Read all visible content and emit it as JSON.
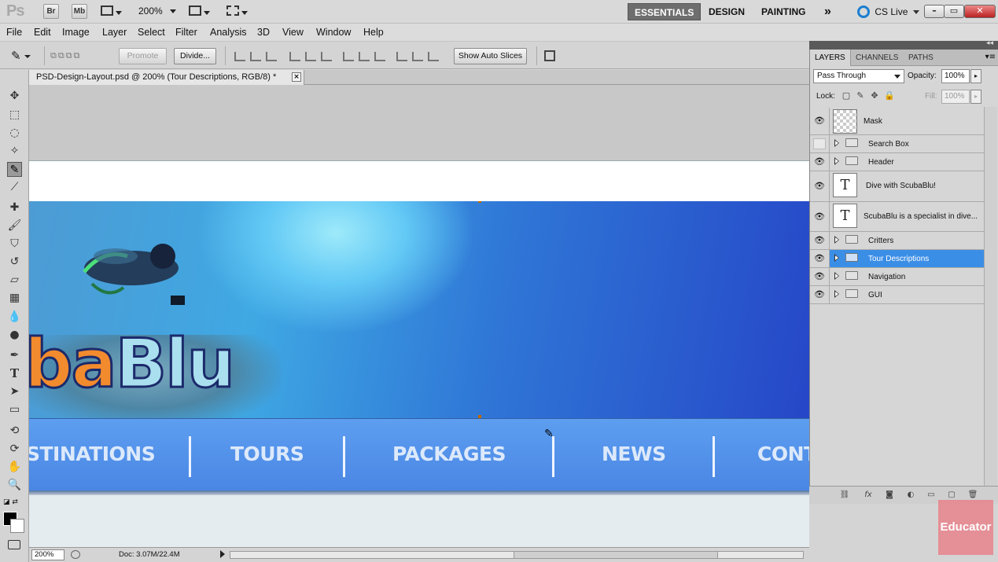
{
  "app": {
    "logo": "Ps",
    "bridge_btn": "Br",
    "minibridge_btn": "Mb",
    "zoom_level": "200%",
    "workspaces": [
      "ESSENTIALS",
      "DESIGN",
      "PAINTING"
    ],
    "more_workspaces": "»",
    "cs_live": "CS Live",
    "window_controls": [
      "–",
      "▭",
      "✕"
    ]
  },
  "menu": [
    "File",
    "Edit",
    "Image",
    "Layer",
    "Select",
    "Filter",
    "Analysis",
    "3D",
    "View",
    "Window",
    "Help"
  ],
  "options_bar": {
    "promote": "Promote",
    "divide": "Divide...",
    "show_auto_slices": "Show Auto Slices"
  },
  "document": {
    "tab_title": "PSD-Design-Layout.psd @ 200% (Tour Descriptions, RGB/8) *",
    "close_glyph": "×",
    "logo_part1": "ba",
    "logo_part2": "Blu",
    "nav_items": [
      "STINATIONS",
      "TOURS",
      "PACKAGES",
      "NEWS",
      "CONT"
    ]
  },
  "status": {
    "zoom": "200%",
    "doc_info": "Doc: 3.07M/22.4M"
  },
  "layers_panel": {
    "tabs": [
      "LAYERS",
      "CHANNELS",
      "PATHS"
    ],
    "blend_mode": "Pass Through",
    "opacity_label": "Opacity:",
    "opacity": "100%",
    "lock_label": "Lock:",
    "fill_label": "Fill:",
    "fill": "100%",
    "layers": [
      {
        "name": "Mask",
        "kind": "pixel",
        "visible": true
      },
      {
        "name": "Search Box",
        "kind": "group",
        "visible": false
      },
      {
        "name": "Header",
        "kind": "group",
        "visible": true
      },
      {
        "name": "Dive with ScubaBlu!",
        "kind": "text",
        "visible": true
      },
      {
        "name": "ScubaBlu is a specialist in dive...",
        "kind": "text",
        "visible": true
      },
      {
        "name": "Critters",
        "kind": "group",
        "visible": true
      },
      {
        "name": "Tour Descriptions",
        "kind": "group",
        "visible": true,
        "selected": true
      },
      {
        "name": "Navigation",
        "kind": "group",
        "visible": true
      },
      {
        "name": "GUI",
        "kind": "group",
        "visible": true
      }
    ]
  },
  "watermark": "Educator",
  "colors": {
    "selection": "#3b8ee6",
    "nav_bar": "#4a86e4",
    "logo_orange": "#f28a2e",
    "logo_light": "#a9dfee"
  }
}
